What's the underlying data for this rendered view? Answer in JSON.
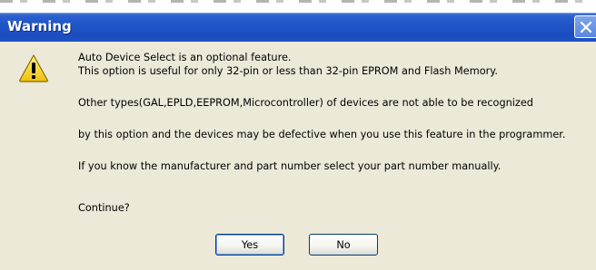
{
  "dialog": {
    "title": "Warning",
    "icon": "warning-icon",
    "message_lines": [
      "Auto Device Select is an optional feature.",
      "This option is useful for only 32-pin or less than 32-pin EPROM and Flash Memory.",
      "Other types(GAL,EPLD,EEPROM,Microcontroller) of devices are not able to be recognized",
      "by this option and the devices may be defective when you use this feature in the programmer.",
      "If you know the manufacturer and part number select your part number manually.",
      "Continue?"
    ],
    "buttons": {
      "yes": "Yes",
      "no": "No"
    }
  },
  "colors": {
    "titlebar": "#1f54c8",
    "dialog_bg": "#ECE9D8",
    "button_border": "#003c74",
    "warning_yellow": "#f5cf20"
  }
}
